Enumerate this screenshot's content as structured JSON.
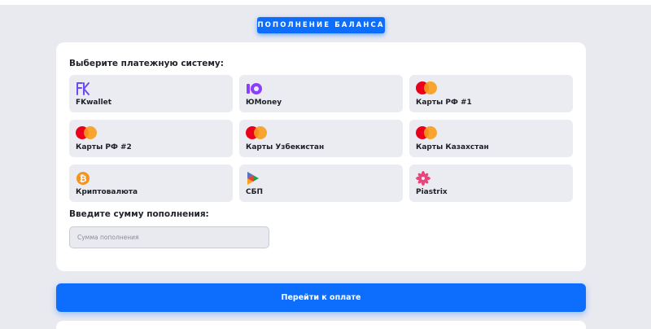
{
  "header": {
    "title": "ПОПОЛНЕНИЕ БАЛАНСА"
  },
  "payment": {
    "system_label": "Выберите платежную систему:",
    "methods": [
      {
        "label": "FKwallet",
        "icon": "fkwallet-logo-icon"
      },
      {
        "label": "ЮMoney",
        "icon": "yumoney-logo-icon"
      },
      {
        "label": "Карты РФ #1",
        "icon": "mastercard-icon"
      },
      {
        "label": "Карты РФ #2",
        "icon": "mastercard-icon"
      },
      {
        "label": "Карты Узбекистан",
        "icon": "mastercard-icon"
      },
      {
        "label": "Карты Казахстан",
        "icon": "mastercard-icon"
      },
      {
        "label": "Криптовалюта",
        "icon": "bitcoin-icon"
      },
      {
        "label": "СБП",
        "icon": "sbp-logo-icon"
      },
      {
        "label": "Piastrix",
        "icon": "piastrix-logo-icon"
      }
    ],
    "amount_label": "Введите сумму пополнения:",
    "amount_placeholder": "Сумма пополнения",
    "submit_label": "Перейти к оплате"
  },
  "colors": {
    "accent": "#0d6efd",
    "background": "#e9eaf0",
    "card": "#ffffff",
    "tile": "#ebecf1"
  }
}
